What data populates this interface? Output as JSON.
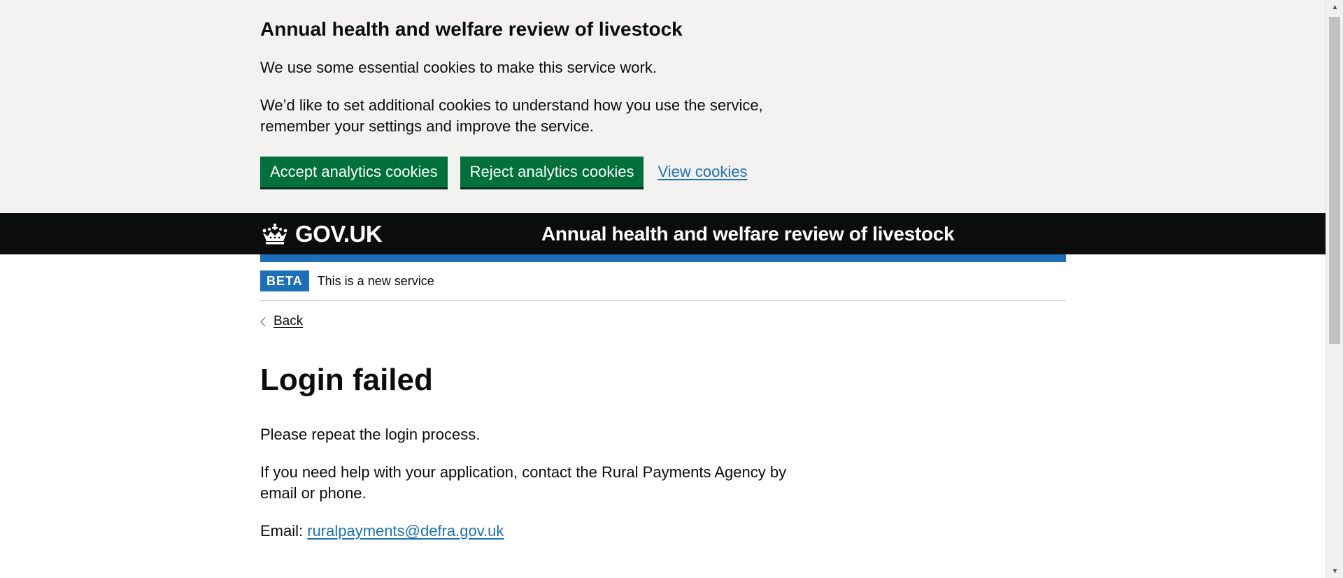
{
  "cookie_banner": {
    "heading": "Annual health and welfare review of livestock",
    "text_essential": "We use some essential cookies to make this service work.",
    "text_additional": "We’d like to set additional cookies to understand how you use the service, remember your settings and improve the service.",
    "accept_label": "Accept analytics cookies",
    "reject_label": "Reject analytics cookies",
    "view_label": "View cookies"
  },
  "header": {
    "logo_text": "GOV.UK",
    "service_name": "Annual health and welfare review of livestock"
  },
  "phase_banner": {
    "tag": "BETA",
    "text": "This is a new service"
  },
  "back_link": {
    "label": "Back"
  },
  "main": {
    "title": "Login failed",
    "paragraph_repeat": "Please repeat the login process.",
    "paragraph_help": "If you need help with your application, contact the Rural Payments Agency by email or phone.",
    "email_label": "Email:",
    "email_address": "ruralpayments@defra.gov.uk"
  },
  "colors": {
    "button_green": "#00703c",
    "link_blue": "#1d70b8",
    "header_black": "#0b0c0c",
    "banner_grey": "#f3f2f1"
  },
  "icons": {
    "logo": "crown-icon",
    "back": "chevron-left-icon",
    "scroll_up": "arrow-up-icon",
    "scroll_down": "arrow-down-icon"
  }
}
